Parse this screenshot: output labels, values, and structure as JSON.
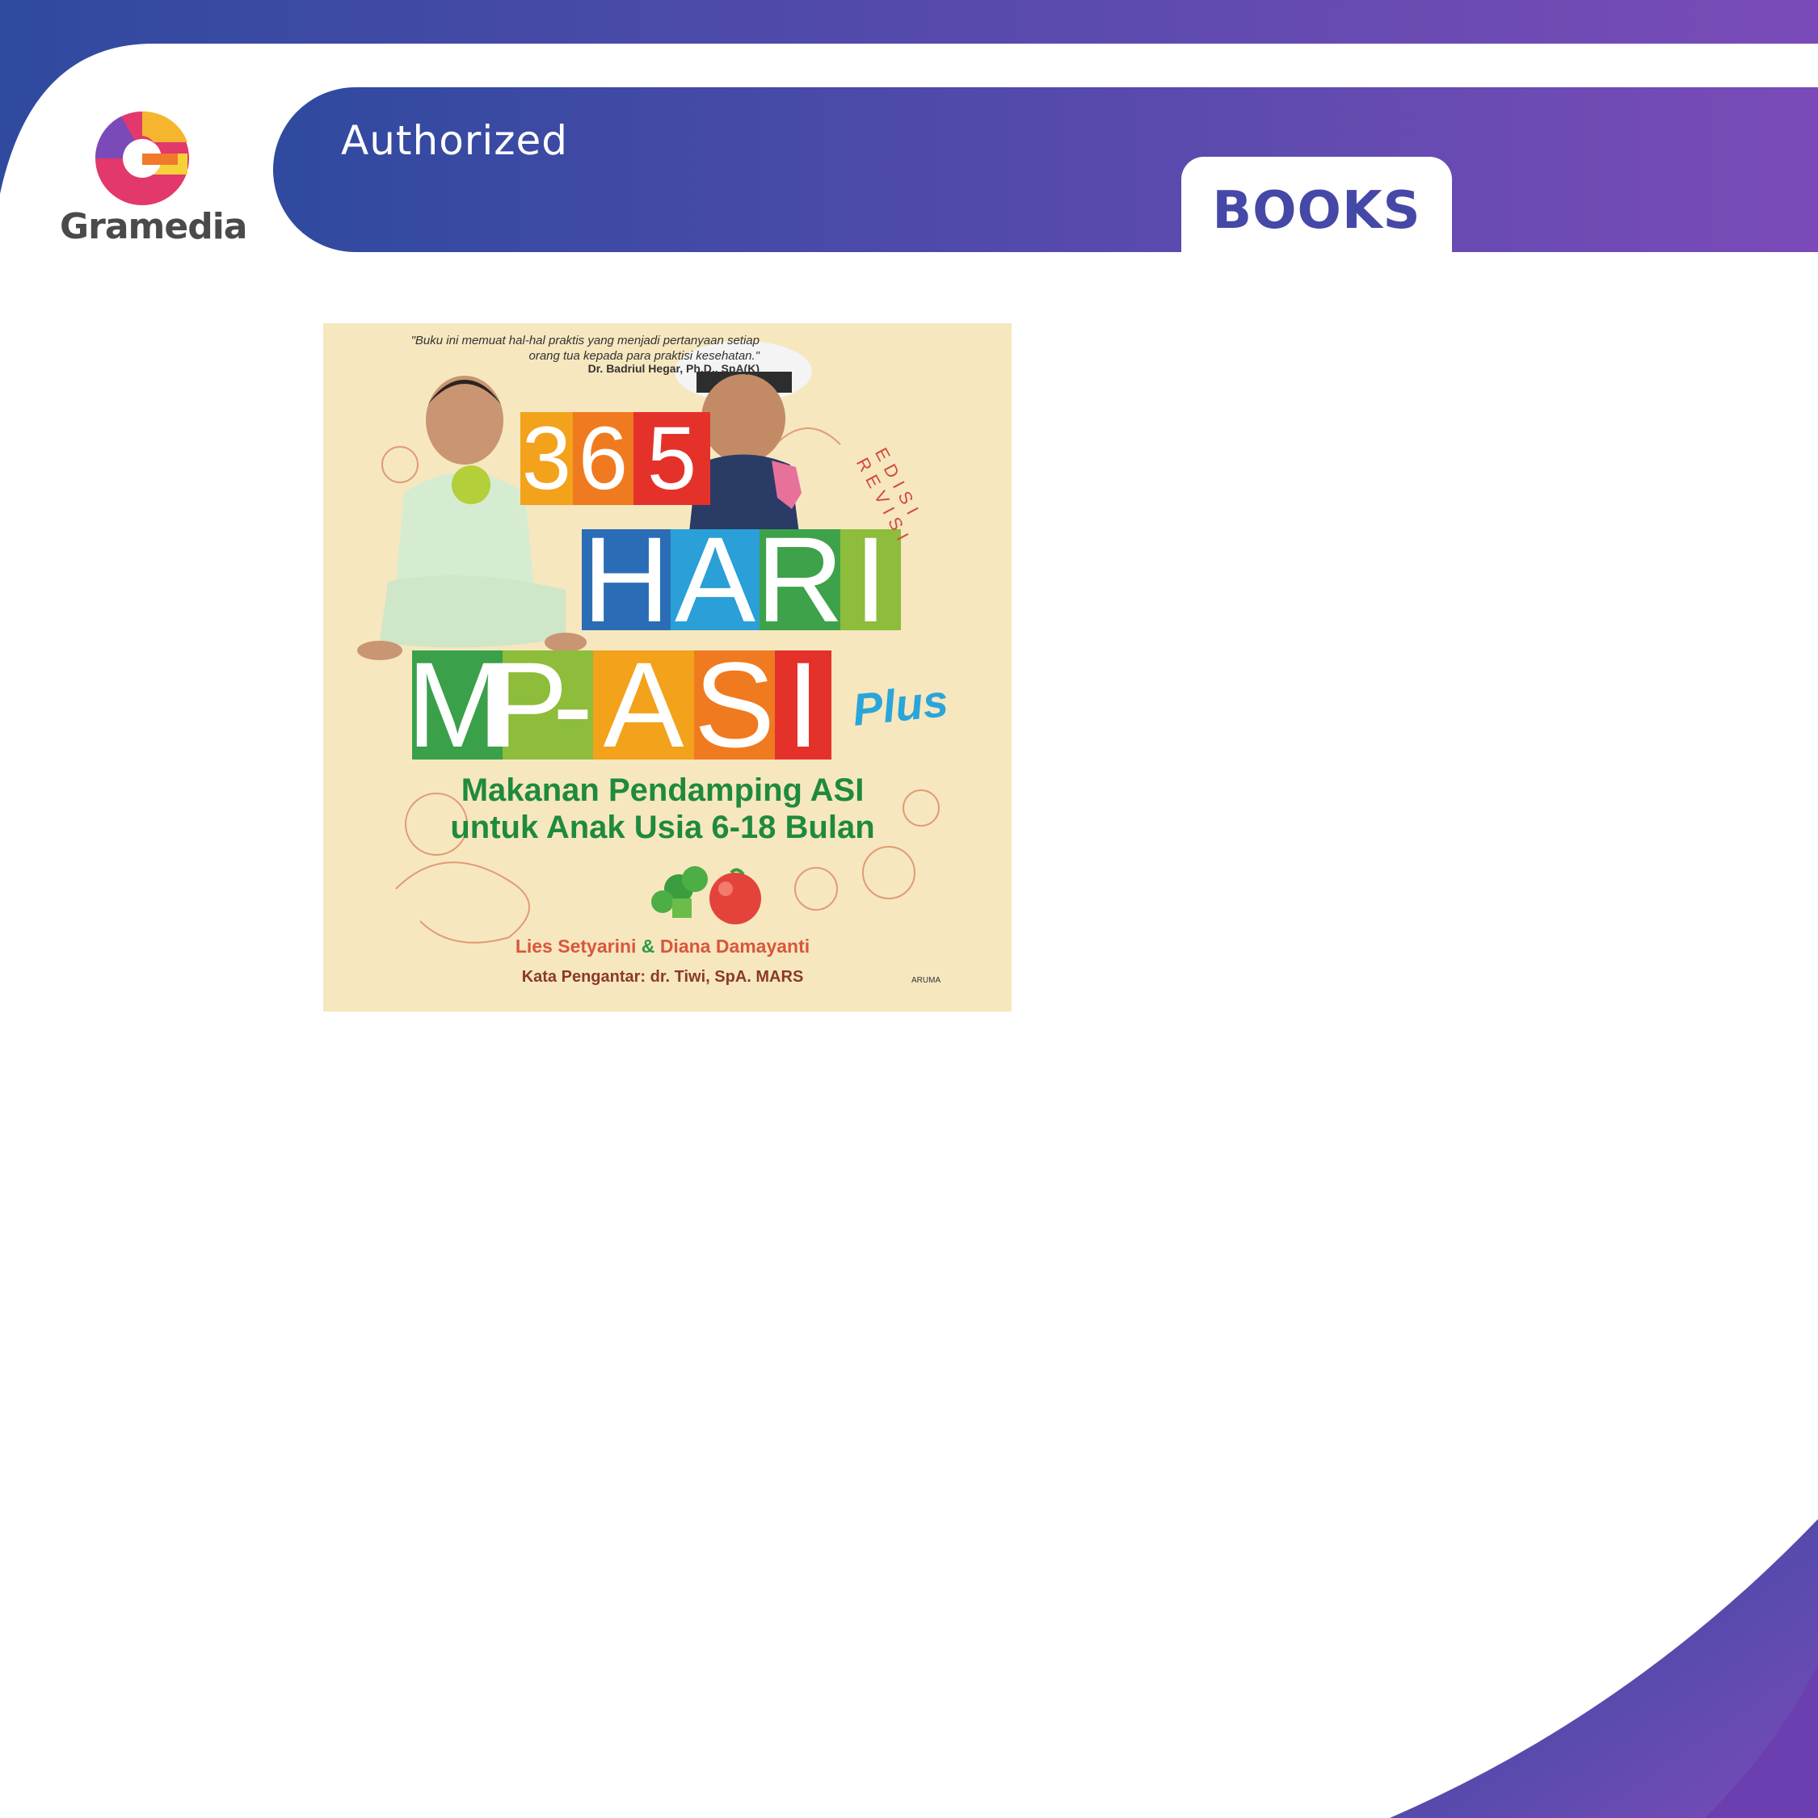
{
  "brand": {
    "name": "Gramedia",
    "colors": {
      "gradient_start": "#2e4aa0",
      "gradient_end": "#7a4bb8",
      "tab_text": "#4548a6"
    }
  },
  "header": {
    "authorized_label": "Authorized",
    "books_tab_label": "BOOKS"
  },
  "book_cover": {
    "quote": "\"Buku ini memuat hal-hal praktis yang menjadi pertanyaan setiap orang tua kepada para praktisi kesehatan.\"",
    "endorser": "Dr. Badriul Hegar, Ph.D., SpA(K)",
    "edition": "EDISI REVISI",
    "title_row1": [
      "3",
      "6",
      "5"
    ],
    "title_row2": [
      "H",
      "A",
      "R",
      "I"
    ],
    "title_row3": [
      "M",
      "P",
      "-",
      "A",
      "S",
      "I"
    ],
    "title_suffix": "Plus",
    "subtitle_line1": "Makanan Pendamping ASI",
    "subtitle_line2": "untuk Anak Usia 6-18 Bulan",
    "author1": "Lies Setyarini",
    "author_separator": "&",
    "author2": "Diana Damayanti",
    "foreword": "Kata Pengantar: dr. Tiwi, SpA. MARS",
    "publisher": "ARUMA"
  }
}
